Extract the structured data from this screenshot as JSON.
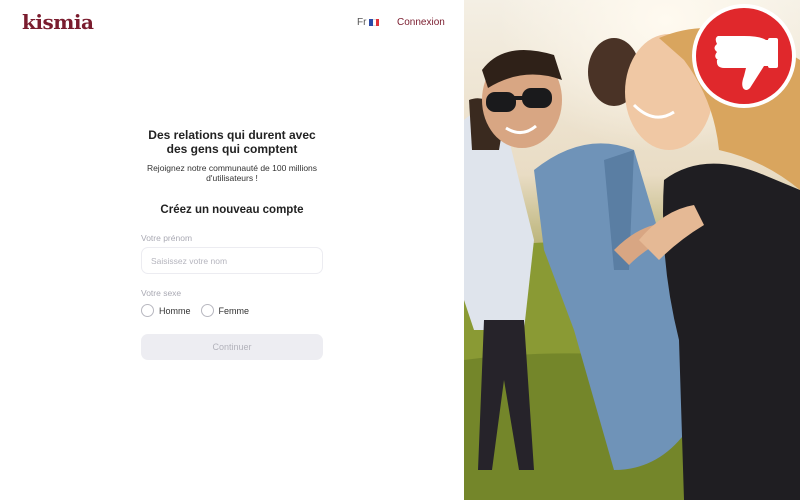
{
  "header": {
    "logo": "kismia",
    "language": "Fr",
    "login_link": "Connexion"
  },
  "signup": {
    "headline": "Des relations qui durent avec des gens qui comptent",
    "subheadline": "Rejoignez notre communauté de 100 millions d'utilisateurs !",
    "form_title": "Créez un nouveau compte",
    "first_name_label": "Votre prénom",
    "first_name_placeholder": "Saisissez votre nom",
    "first_name_value": "",
    "gender_label": "Votre sexe",
    "gender_options": [
      "Homme",
      "Femme"
    ],
    "continue_label": "Continuer"
  },
  "colors": {
    "brand": "#7a1c2e",
    "badge_red": "#e0282c",
    "disabled_button": "#ededf2"
  },
  "icons": {
    "flag": "france-flag-icon",
    "badge": "thumbs-down-icon"
  }
}
